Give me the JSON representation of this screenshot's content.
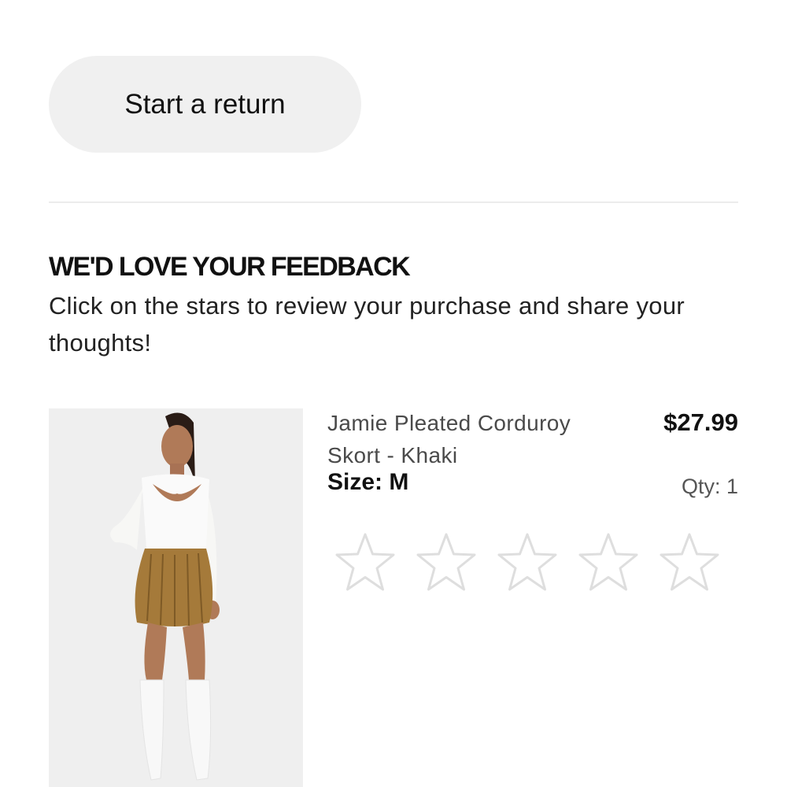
{
  "returns": {
    "start_return_label": "Start a return"
  },
  "feedback": {
    "title": "WE'D LOVE YOUR FEEDBACK",
    "subtitle": "Click on the stars to review your purchase and share your thoughts!"
  },
  "product": {
    "name": "Jamie Pleated Corduroy Skort - Khaki",
    "price": "$27.99",
    "size_label": "Size: M",
    "qty_label": "Qty: 1",
    "rating": {
      "max_stars": 5,
      "filled_stars": 0
    }
  },
  "colors": {
    "button_bg": "#f0f0f0",
    "star_outline": "#dedede",
    "text_primary": "#111111",
    "text_secondary": "#4a4a4a"
  }
}
